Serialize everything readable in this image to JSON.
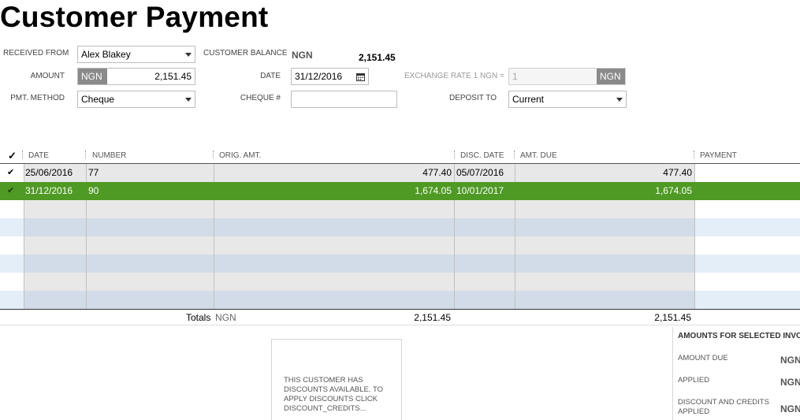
{
  "title": "Customer Payment",
  "form": {
    "received_from_label": "RECEIVED FROM",
    "received_from_value": "Alex Blakey",
    "customer_balance_label": "CUSTOMER BALANCE",
    "customer_balance_currency": "NGN",
    "customer_balance_value": "2,151.45",
    "amount_label": "AMOUNT",
    "amount_currency": "NGN",
    "amount_value": "2,151.45",
    "date_label": "DATE",
    "date_value": "31/12/2016",
    "exchange_rate_label": "EXCHANGE RATE 1 NGN =",
    "exchange_rate_value": "1",
    "exchange_rate_currency": "NGN",
    "pmt_method_label": "PMT. METHOD",
    "pmt_method_value": "Cheque",
    "cheque_label": "CHEQUE #",
    "cheque_value": "",
    "deposit_to_label": "DEPOSIT TO",
    "deposit_to_value": "Current"
  },
  "table": {
    "check_header": "✓",
    "columns": [
      "DATE",
      "NUMBER",
      "ORIG. AMT.",
      "DISC. DATE",
      "AMT. DUE",
      "PAYMENT"
    ],
    "rows": [
      {
        "checked": "✔",
        "date": "25/06/2016",
        "number": "77",
        "orig_amt": "477.40",
        "disc_date": "05/07/2016",
        "amt_due": "477.40",
        "payment": ""
      },
      {
        "checked": "✔",
        "date": "31/12/2016",
        "number": "90",
        "orig_amt": "1,674.05",
        "disc_date": "10/01/2017",
        "amt_due": "1,674.05",
        "payment": ""
      }
    ],
    "totals_label": "Totals",
    "totals_currency": "NGN",
    "totals_orig_amt": "2,151.45",
    "totals_amt_due": "2,151.45"
  },
  "discount_message": "THIS CUSTOMER HAS DISCOUNTS AVAILABLE. TO APPLY DISCOUNTS CLICK DISCOUNT_CREDITS...",
  "amounts_panel": {
    "title": "AMOUNTS FOR SELECTED INVO",
    "amount_due_label": "AMOUNT DUE",
    "amount_due_currency": "NGN",
    "applied_label": "APPLIED",
    "applied_currency": "NGN",
    "discount_label": "DISCOUNT AND CREDITS APPLIED",
    "discount_currency": "NGN"
  },
  "colors": {
    "selected_row": "#4e9a24",
    "row_gray": "#e8e8e8",
    "row_blue": "#d2dce8",
    "row_white_blue": "#e3eef9"
  },
  "icons": {
    "calendar": "calendar-icon",
    "dropdown": "chevron-down-icon"
  }
}
